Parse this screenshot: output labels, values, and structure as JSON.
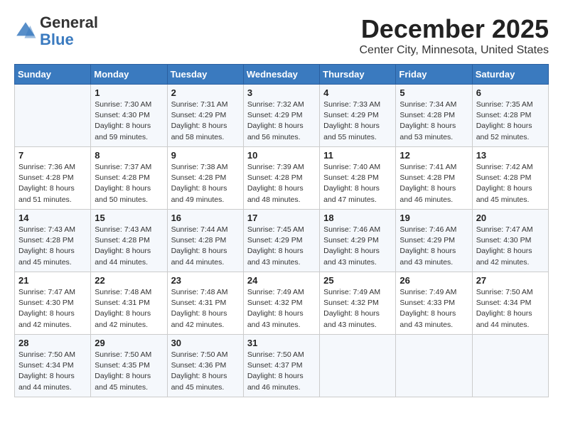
{
  "header": {
    "logo_general": "General",
    "logo_blue": "Blue",
    "month": "December 2025",
    "location": "Center City, Minnesota, United States"
  },
  "weekdays": [
    "Sunday",
    "Monday",
    "Tuesday",
    "Wednesday",
    "Thursday",
    "Friday",
    "Saturday"
  ],
  "weeks": [
    [
      {
        "day": "",
        "sunrise": "",
        "sunset": "",
        "daylight": ""
      },
      {
        "day": "1",
        "sunrise": "Sunrise: 7:30 AM",
        "sunset": "Sunset: 4:30 PM",
        "daylight": "Daylight: 8 hours and 59 minutes."
      },
      {
        "day": "2",
        "sunrise": "Sunrise: 7:31 AM",
        "sunset": "Sunset: 4:29 PM",
        "daylight": "Daylight: 8 hours and 58 minutes."
      },
      {
        "day": "3",
        "sunrise": "Sunrise: 7:32 AM",
        "sunset": "Sunset: 4:29 PM",
        "daylight": "Daylight: 8 hours and 56 minutes."
      },
      {
        "day": "4",
        "sunrise": "Sunrise: 7:33 AM",
        "sunset": "Sunset: 4:29 PM",
        "daylight": "Daylight: 8 hours and 55 minutes."
      },
      {
        "day": "5",
        "sunrise": "Sunrise: 7:34 AM",
        "sunset": "Sunset: 4:28 PM",
        "daylight": "Daylight: 8 hours and 53 minutes."
      },
      {
        "day": "6",
        "sunrise": "Sunrise: 7:35 AM",
        "sunset": "Sunset: 4:28 PM",
        "daylight": "Daylight: 8 hours and 52 minutes."
      }
    ],
    [
      {
        "day": "7",
        "sunrise": "Sunrise: 7:36 AM",
        "sunset": "Sunset: 4:28 PM",
        "daylight": "Daylight: 8 hours and 51 minutes."
      },
      {
        "day": "8",
        "sunrise": "Sunrise: 7:37 AM",
        "sunset": "Sunset: 4:28 PM",
        "daylight": "Daylight: 8 hours and 50 minutes."
      },
      {
        "day": "9",
        "sunrise": "Sunrise: 7:38 AM",
        "sunset": "Sunset: 4:28 PM",
        "daylight": "Daylight: 8 hours and 49 minutes."
      },
      {
        "day": "10",
        "sunrise": "Sunrise: 7:39 AM",
        "sunset": "Sunset: 4:28 PM",
        "daylight": "Daylight: 8 hours and 48 minutes."
      },
      {
        "day": "11",
        "sunrise": "Sunrise: 7:40 AM",
        "sunset": "Sunset: 4:28 PM",
        "daylight": "Daylight: 8 hours and 47 minutes."
      },
      {
        "day": "12",
        "sunrise": "Sunrise: 7:41 AM",
        "sunset": "Sunset: 4:28 PM",
        "daylight": "Daylight: 8 hours and 46 minutes."
      },
      {
        "day": "13",
        "sunrise": "Sunrise: 7:42 AM",
        "sunset": "Sunset: 4:28 PM",
        "daylight": "Daylight: 8 hours and 45 minutes."
      }
    ],
    [
      {
        "day": "14",
        "sunrise": "Sunrise: 7:43 AM",
        "sunset": "Sunset: 4:28 PM",
        "daylight": "Daylight: 8 hours and 45 minutes."
      },
      {
        "day": "15",
        "sunrise": "Sunrise: 7:43 AM",
        "sunset": "Sunset: 4:28 PM",
        "daylight": "Daylight: 8 hours and 44 minutes."
      },
      {
        "day": "16",
        "sunrise": "Sunrise: 7:44 AM",
        "sunset": "Sunset: 4:28 PM",
        "daylight": "Daylight: 8 hours and 44 minutes."
      },
      {
        "day": "17",
        "sunrise": "Sunrise: 7:45 AM",
        "sunset": "Sunset: 4:29 PM",
        "daylight": "Daylight: 8 hours and 43 minutes."
      },
      {
        "day": "18",
        "sunrise": "Sunrise: 7:46 AM",
        "sunset": "Sunset: 4:29 PM",
        "daylight": "Daylight: 8 hours and 43 minutes."
      },
      {
        "day": "19",
        "sunrise": "Sunrise: 7:46 AM",
        "sunset": "Sunset: 4:29 PM",
        "daylight": "Daylight: 8 hours and 43 minutes."
      },
      {
        "day": "20",
        "sunrise": "Sunrise: 7:47 AM",
        "sunset": "Sunset: 4:30 PM",
        "daylight": "Daylight: 8 hours and 42 minutes."
      }
    ],
    [
      {
        "day": "21",
        "sunrise": "Sunrise: 7:47 AM",
        "sunset": "Sunset: 4:30 PM",
        "daylight": "Daylight: 8 hours and 42 minutes."
      },
      {
        "day": "22",
        "sunrise": "Sunrise: 7:48 AM",
        "sunset": "Sunset: 4:31 PM",
        "daylight": "Daylight: 8 hours and 42 minutes."
      },
      {
        "day": "23",
        "sunrise": "Sunrise: 7:48 AM",
        "sunset": "Sunset: 4:31 PM",
        "daylight": "Daylight: 8 hours and 42 minutes."
      },
      {
        "day": "24",
        "sunrise": "Sunrise: 7:49 AM",
        "sunset": "Sunset: 4:32 PM",
        "daylight": "Daylight: 8 hours and 43 minutes."
      },
      {
        "day": "25",
        "sunrise": "Sunrise: 7:49 AM",
        "sunset": "Sunset: 4:32 PM",
        "daylight": "Daylight: 8 hours and 43 minutes."
      },
      {
        "day": "26",
        "sunrise": "Sunrise: 7:49 AM",
        "sunset": "Sunset: 4:33 PM",
        "daylight": "Daylight: 8 hours and 43 minutes."
      },
      {
        "day": "27",
        "sunrise": "Sunrise: 7:50 AM",
        "sunset": "Sunset: 4:34 PM",
        "daylight": "Daylight: 8 hours and 44 minutes."
      }
    ],
    [
      {
        "day": "28",
        "sunrise": "Sunrise: 7:50 AM",
        "sunset": "Sunset: 4:34 PM",
        "daylight": "Daylight: 8 hours and 44 minutes."
      },
      {
        "day": "29",
        "sunrise": "Sunrise: 7:50 AM",
        "sunset": "Sunset: 4:35 PM",
        "daylight": "Daylight: 8 hours and 45 minutes."
      },
      {
        "day": "30",
        "sunrise": "Sunrise: 7:50 AM",
        "sunset": "Sunset: 4:36 PM",
        "daylight": "Daylight: 8 hours and 45 minutes."
      },
      {
        "day": "31",
        "sunrise": "Sunrise: 7:50 AM",
        "sunset": "Sunset: 4:37 PM",
        "daylight": "Daylight: 8 hours and 46 minutes."
      },
      {
        "day": "",
        "sunrise": "",
        "sunset": "",
        "daylight": ""
      },
      {
        "day": "",
        "sunrise": "",
        "sunset": "",
        "daylight": ""
      },
      {
        "day": "",
        "sunrise": "",
        "sunset": "",
        "daylight": ""
      }
    ]
  ]
}
